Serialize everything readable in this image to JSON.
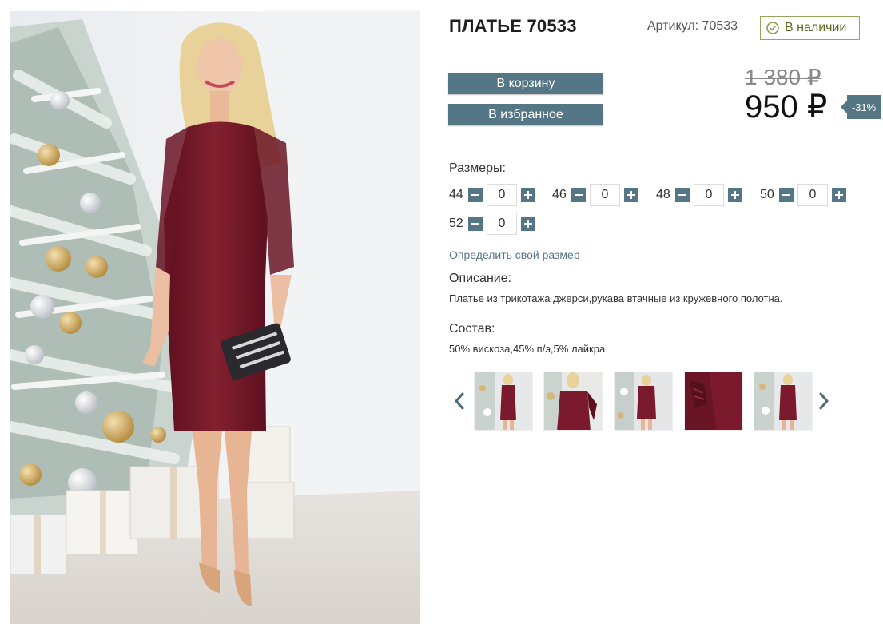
{
  "product": {
    "title": "ПЛАТЬЕ 70533",
    "sku": "Артикул: 70533",
    "stock_status": "В наличии"
  },
  "buttons": {
    "cart": "В корзину",
    "favorite": "В избранное"
  },
  "price": {
    "old": "1 380 ₽",
    "current": "950 ₽",
    "discount": "-31%"
  },
  "sizes": {
    "label": "Размеры:",
    "items": [
      {
        "size": "44",
        "qty": "0"
      },
      {
        "size": "46",
        "qty": "0"
      },
      {
        "size": "48",
        "qty": "0"
      },
      {
        "size": "50",
        "qty": "0"
      },
      {
        "size": "52",
        "qty": "0"
      }
    ],
    "size_link": "Определить свой размер"
  },
  "description": {
    "label": "Описание:",
    "text": "Платье из трикотажа джерси,рукава втачные из кружевного полотна."
  },
  "composition": {
    "label": "Состав:",
    "text": "50% вискоза,45% п/э,5% лайкра"
  },
  "colors": {
    "accent": "#557785",
    "stock_border": "#9aa35a",
    "dress": "#7b1a2c"
  },
  "icons": {
    "stock": "check-circle-icon",
    "prev": "chevron-left-icon",
    "next": "chevron-right-icon"
  }
}
